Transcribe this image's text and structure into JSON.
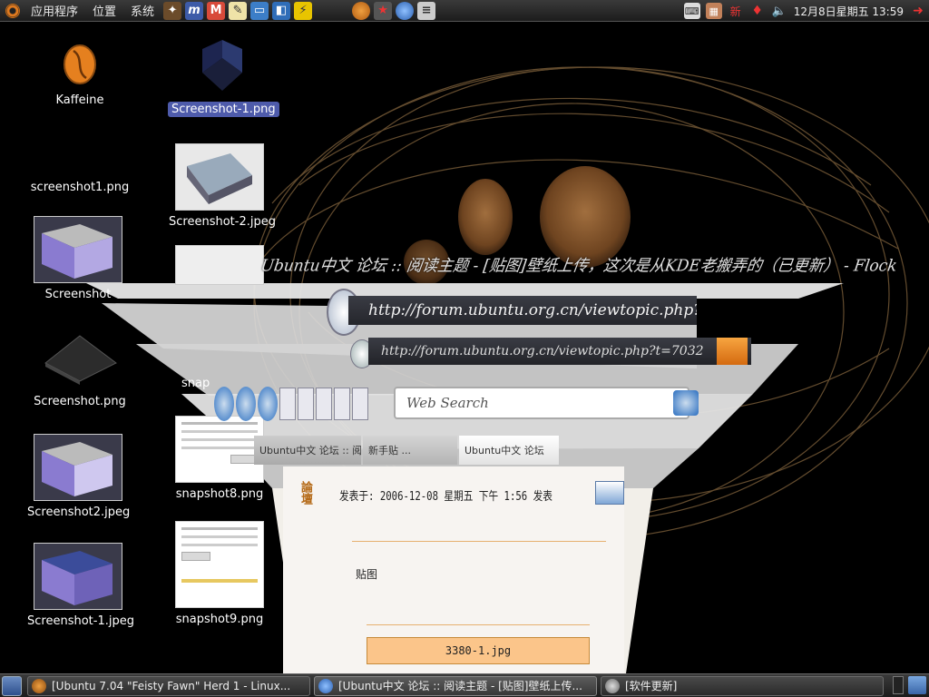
{
  "top_panel": {
    "menus": [
      "应用程序",
      "位置",
      "系统"
    ],
    "clock": "12月8日星期五 13:59",
    "tray_badge": "新"
  },
  "desktop_icons": [
    {
      "label": "Kaffeine",
      "selected": false
    },
    {
      "label": "Screenshot-1.png",
      "selected": true
    },
    {
      "label": "screenshot1.png",
      "selected": false
    },
    {
      "label": "Screenshot-2.jpeg",
      "selected": false
    },
    {
      "label": "Screenshot",
      "selected": false
    },
    {
      "label": "Screenshot.png",
      "selected": false
    },
    {
      "label": "snap",
      "selected": false
    },
    {
      "label": "Screenshot2.jpeg",
      "selected": false
    },
    {
      "label": "snapshot8.png",
      "selected": false
    },
    {
      "label": "Screenshot-1.jpeg",
      "selected": false
    },
    {
      "label": "snapshot9.png",
      "selected": false
    }
  ],
  "flock_window": {
    "title": "Ubuntu中文 论坛 :: 阅读主题 - [贴图]壁纸上传，这次是从KDE老搬弄的（已更新） - Flock",
    "url": "http://forum.ubuntu.org.cn/viewtopic.php?t=7032",
    "url_short": "http://forum.ubuntu.org.cn/viewtopic.php?t=7032",
    "search_placeholder": "Web Search",
    "tabs": [
      "Ubuntu中文 论坛 :: 阅读主题",
      "新手贴 ...",
      "Ubuntu中文 论坛"
    ],
    "post_time": "发表于: 2006-12-08 星期五 下午 1:56   发表",
    "post_body": "贴图",
    "image_caption": "3380-1.jpg"
  },
  "taskbar": {
    "tasks": [
      {
        "label": "[Ubuntu 7.04 \"Feisty Fawn\" Herd 1 - Linux...",
        "active": false
      },
      {
        "label": "[Ubuntu中文 论坛 :: 阅读主题 - [贴图]壁纸上传...",
        "active": true
      },
      {
        "label": "[软件更新]",
        "active": false
      }
    ]
  },
  "colors": {
    "panel": "#2b2b2b",
    "selection": "#4e5bab",
    "ubuntu_orange": "#e07a1f",
    "kaffeine_orange": "#e5801f"
  }
}
